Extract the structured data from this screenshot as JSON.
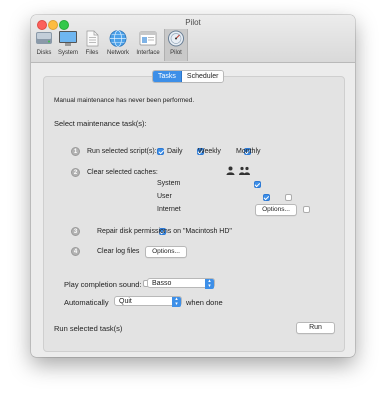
{
  "window": {
    "title": "Pilot"
  },
  "toolbar": {
    "items": [
      {
        "label": "Disks",
        "icon": "disks-icon"
      },
      {
        "label": "System",
        "icon": "system-icon"
      },
      {
        "label": "Files",
        "icon": "files-icon"
      },
      {
        "label": "Network",
        "icon": "network-icon"
      },
      {
        "label": "Interface",
        "icon": "interface-icon"
      },
      {
        "label": "Pilot",
        "icon": "pilot-icon",
        "selected": true
      }
    ]
  },
  "tabs": {
    "tasks": "Tasks",
    "scheduler": "Scheduler",
    "active": "Tasks"
  },
  "status_message": "Manual maintenance has never been performed.",
  "section_heading": "Select maintenance task(s):",
  "tasks": {
    "t1": {
      "number": "1",
      "label": "Run selected script(s):",
      "daily": "Daily",
      "weekly": "Weekly",
      "monthly": "Monthly",
      "daily_checked": true,
      "weekly_checked": true,
      "monthly_checked": true
    },
    "t2": {
      "number": "2",
      "label": "Clear selected caches:",
      "rows": {
        "system": "System",
        "user": "User",
        "internet": "Internet"
      },
      "options": "Options..."
    },
    "t3": {
      "number": "3",
      "label": "Repair disk permissions on \"Macintosh HD\"",
      "checked": true
    },
    "t4": {
      "number": "4",
      "label": "Clear log files",
      "checked": true,
      "options": "Options..."
    }
  },
  "completion": {
    "label": "Play completion sound:",
    "checked": false,
    "value": "Basso"
  },
  "auto": {
    "label": "Automatically",
    "checked": false,
    "value": "Quit",
    "suffix": "when done"
  },
  "footer": {
    "label": "Run selected task(s)",
    "run": "Run"
  },
  "colors": {
    "accent": "#3d8fe8"
  }
}
